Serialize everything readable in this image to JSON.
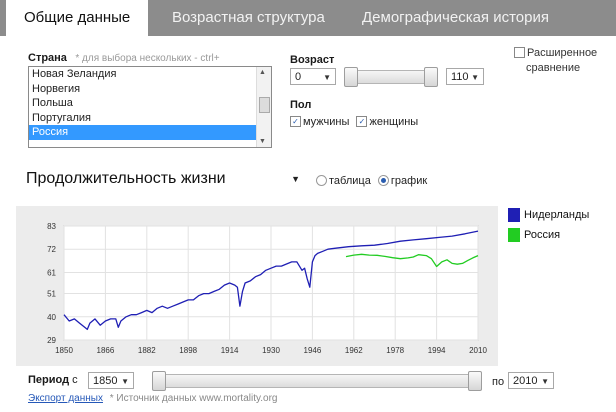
{
  "tabs": [
    "Общие данные",
    "Возрастная структура",
    "Демографическая история"
  ],
  "country": {
    "label": "Страна",
    "hint": "* для выбора нескольких - ctrl+",
    "items": [
      "Новая Зеландия",
      "Норвегия",
      "Польша",
      "Португалия",
      "Россия"
    ],
    "selected": "Россия"
  },
  "age": {
    "label": "Возраст",
    "from": "0",
    "to": "110"
  },
  "sex": {
    "label": "Пол",
    "male": "мужчины",
    "female": "женщины",
    "male_checked": true,
    "female_checked": true
  },
  "compare": {
    "label_line1": "Расширенное",
    "label_line2": "сравнение",
    "checked": false
  },
  "indicator": {
    "value": "Продолжительность жизни"
  },
  "view": {
    "table": "таблица",
    "graph": "график",
    "selected": "график"
  },
  "period": {
    "label": "Период",
    "from_label": "с",
    "from": "1850",
    "to_label": "по",
    "to": "2010"
  },
  "footer": {
    "export": "Экспорт данных",
    "source": "* Источник данных www.mortality.org"
  },
  "colors": {
    "netherlands": "#1f1fb4",
    "russia": "#22cc22"
  },
  "chart_data": {
    "type": "line",
    "xlim": [
      1850,
      2010
    ],
    "ylim": [
      29,
      83
    ],
    "x_ticks": [
      1850,
      1866,
      1882,
      1898,
      1914,
      1930,
      1946,
      1962,
      1978,
      1994,
      2010
    ],
    "y_ticks": [
      29,
      40,
      51,
      61,
      72,
      83
    ],
    "grid": true,
    "legend": [
      "Нидерланды",
      "Россия"
    ],
    "series": [
      {
        "name": "Нидерланды",
        "x": [
          1850,
          1852,
          1854,
          1856,
          1858,
          1859,
          1860,
          1862,
          1864,
          1866,
          1868,
          1870,
          1871,
          1872,
          1874,
          1876,
          1878,
          1880,
          1882,
          1884,
          1886,
          1888,
          1890,
          1892,
          1894,
          1896,
          1898,
          1900,
          1902,
          1904,
          1906,
          1908,
          1910,
          1912,
          1914,
          1916,
          1917,
          1918,
          1919,
          1920,
          1922,
          1924,
          1926,
          1928,
          1930,
          1932,
          1934,
          1936,
          1938,
          1940,
          1942,
          1943,
          1944,
          1945,
          1946,
          1947,
          1948,
          1950,
          1952,
          1955,
          1960,
          1965,
          1970,
          1975,
          1980,
          1985,
          1990,
          1995,
          2000,
          2005,
          2010
        ],
        "values": [
          41,
          38,
          39,
          37,
          35,
          34,
          37,
          39,
          36,
          38,
          39,
          39,
          35,
          38,
          40,
          41,
          41,
          42,
          43,
          42,
          44,
          45,
          44,
          45,
          46,
          47,
          48,
          48,
          50,
          51,
          51,
          52,
          53,
          55,
          56,
          55,
          54,
          45,
          52,
          56,
          57,
          59,
          60,
          62,
          63,
          64,
          64,
          65,
          66,
          66,
          62,
          63,
          58,
          54,
          66,
          69,
          70,
          71,
          72,
          72.5,
          73.2,
          73.6,
          73.9,
          74.7,
          75.8,
          76.4,
          77.0,
          77.6,
          78.2,
          79.3,
          80.6
        ]
      },
      {
        "name": "Россия",
        "x": [
          1959,
          1962,
          1965,
          1968,
          1971,
          1974,
          1977,
          1980,
          1983,
          1985,
          1987,
          1990,
          1992,
          1994,
          1996,
          1998,
          2000,
          2002,
          2004,
          2006,
          2008,
          2010
        ],
        "values": [
          68.5,
          69.2,
          69.6,
          69.2,
          69.1,
          68.6,
          68.0,
          67.5,
          67.9,
          68.3,
          69.4,
          69.0,
          67.5,
          63.8,
          66.0,
          67.0,
          65.3,
          64.9,
          65.3,
          66.6,
          67.9,
          69.0
        ]
      }
    ]
  }
}
